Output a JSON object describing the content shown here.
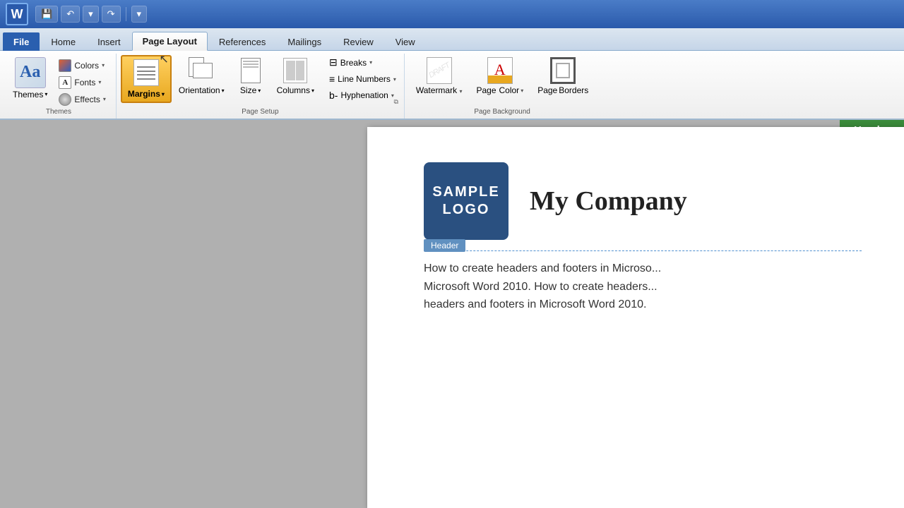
{
  "titleBar": {
    "wordLetter": "W",
    "buttons": [
      "save",
      "undo",
      "redo",
      "customize"
    ]
  },
  "ribbon": {
    "tabs": [
      {
        "id": "file",
        "label": "File",
        "active": false,
        "special": true
      },
      {
        "id": "home",
        "label": "Home",
        "active": false
      },
      {
        "id": "insert",
        "label": "Insert",
        "active": false
      },
      {
        "id": "page-layout",
        "label": "Page Layout",
        "active": true
      },
      {
        "id": "references",
        "label": "References",
        "active": false
      },
      {
        "id": "mailings",
        "label": "Mailings",
        "active": false
      },
      {
        "id": "review",
        "label": "Review",
        "active": false
      },
      {
        "id": "view",
        "label": "View",
        "active": false
      }
    ],
    "groups": {
      "themes": {
        "label": "Themes",
        "themeBtn": "Aa",
        "themesLabel": "Themes",
        "colorsLabel": "Colors",
        "fontsLabel": "Fonts",
        "effectsLabel": "Effects"
      },
      "pageSetup": {
        "label": "Page Setup",
        "buttons": [
          {
            "id": "margins",
            "label": "Margins",
            "highlighted": true
          },
          {
            "id": "orientation",
            "label": "Orientation"
          },
          {
            "id": "size",
            "label": "Size"
          },
          {
            "id": "columns",
            "label": "Columns"
          }
        ],
        "rightButtons": [
          {
            "id": "breaks",
            "label": "Breaks"
          },
          {
            "id": "line-numbers",
            "label": "Line Numbers"
          },
          {
            "id": "hyphenation",
            "label": "Hyphenation"
          }
        ]
      },
      "pageBackground": {
        "label": "Page Background",
        "buttons": [
          {
            "id": "watermark",
            "label": "Watermark"
          },
          {
            "id": "page-color",
            "label": "Page\nColor"
          },
          {
            "id": "page-borders",
            "label": "Page\nBorders"
          }
        ]
      }
    }
  },
  "document": {
    "logo": {
      "line1": "SAMPLE",
      "line2": "LOGO"
    },
    "companyName": "My Company",
    "headerLabel": "Header",
    "bodyText": "How to create headers and footers in Microso...",
    "bodyText2": "Microsoft Word 2010.  How to create headers...",
    "bodyText3": "headers and footers in Microsoft Word 2010."
  },
  "headerBanner": "Header"
}
